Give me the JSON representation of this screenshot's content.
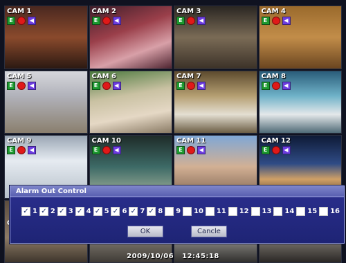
{
  "cameras": [
    {
      "label": "CAM 1"
    },
    {
      "label": "CAM 2"
    },
    {
      "label": "CAM 3"
    },
    {
      "label": "CAM 4"
    },
    {
      "label": "CAM 5"
    },
    {
      "label": "CAM 6"
    },
    {
      "label": "CAM 7"
    },
    {
      "label": "CAM 8"
    },
    {
      "label": "CAM 9"
    },
    {
      "label": "CAM 10"
    },
    {
      "label": "CAM 11"
    },
    {
      "label": "CAM 12"
    },
    {
      "label": "C"
    },
    {
      "label": ""
    },
    {
      "label": ""
    },
    {
      "label": ""
    }
  ],
  "status_icons": {
    "rec_glyph": "E",
    "audio_glyph": "◀"
  },
  "dialog": {
    "title": "Alarm Out Control",
    "options": [
      {
        "number": "1",
        "checked": true
      },
      {
        "number": "2",
        "checked": true
      },
      {
        "number": "3",
        "checked": true
      },
      {
        "number": "4",
        "checked": true
      },
      {
        "number": "5",
        "checked": true
      },
      {
        "number": "6",
        "checked": true
      },
      {
        "number": "7",
        "checked": true
      },
      {
        "number": "8",
        "checked": true
      },
      {
        "number": "9",
        "checked": false
      },
      {
        "number": "10",
        "checked": false
      },
      {
        "number": "11",
        "checked": false
      },
      {
        "number": "12",
        "checked": false
      },
      {
        "number": "13",
        "checked": false
      },
      {
        "number": "14",
        "checked": false
      },
      {
        "number": "15",
        "checked": false
      },
      {
        "number": "16",
        "checked": false
      }
    ],
    "ok_label": "OK",
    "cancel_label": "Cancle"
  },
  "status_bar": {
    "date": "2009/10/06",
    "time": "12:45:18"
  },
  "colors": {
    "dialog_bg": "#1e2475",
    "title_bar": "#585fb1",
    "rec_icon": "#1c9a2f",
    "alarm_icon": "#e01919",
    "audio_icon": "#6d3de0"
  }
}
